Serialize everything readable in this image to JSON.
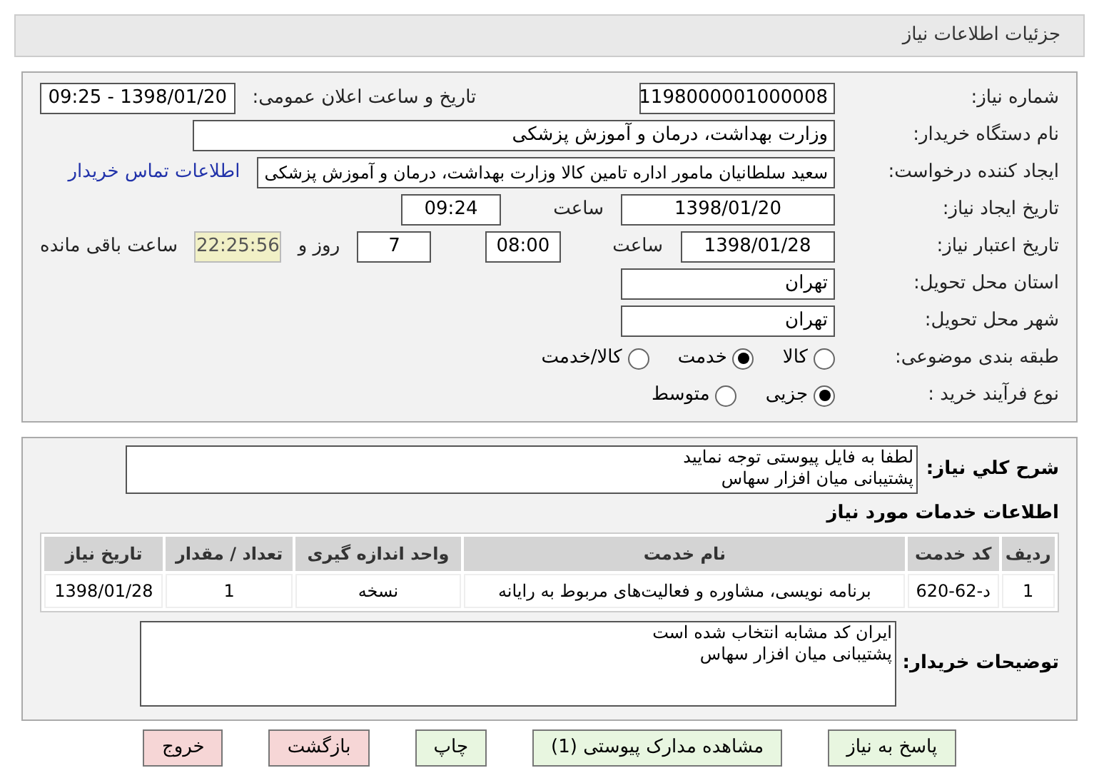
{
  "header": {
    "title": "جزئیات اطلاعات نیاز"
  },
  "details": {
    "need_number": {
      "label": "شماره نیاز:",
      "value": "1198000001000008"
    },
    "announce": {
      "label": "تاریخ و ساعت اعلان عمومی:",
      "value": "1398/01/20 - 09:25"
    },
    "buyer": {
      "label": "نام دستگاه خریدار:",
      "value": "وزارت بهداشت، درمان و آموزش پزشکی"
    },
    "creator": {
      "label": "ایجاد کننده درخواست:",
      "value": "سعید سلطانیان مامور اداره تامین کالا وزارت بهداشت، درمان و آموزش پزشکی",
      "link": "اطلاعات تماس خریدار"
    },
    "created": {
      "label": "تاریخ ایجاد نیاز:",
      "date": "1398/01/20",
      "time_label": "ساعت",
      "time": "09:24"
    },
    "validity": {
      "label": "تاریخ اعتبار نیاز:",
      "date": "1398/01/28",
      "time_label": "ساعت",
      "time": "08:00",
      "days": "7",
      "days_label": "روز و",
      "remaining": "22:25:56",
      "remaining_label": "ساعت باقی مانده"
    },
    "province": {
      "label": "استان محل تحویل:",
      "value": "تهران"
    },
    "city": {
      "label": "شهر محل تحویل:",
      "value": "تهران"
    },
    "category": {
      "label": "طبقه بندی موضوعی:",
      "options": [
        {
          "label": "کالا",
          "selected": false
        },
        {
          "label": "خدمت",
          "selected": true
        },
        {
          "label": "کالا/خدمت",
          "selected": false
        }
      ]
    },
    "process": {
      "label": "نوع فرآیند خرید :",
      "options": [
        {
          "label": "جزیی",
          "selected": true
        },
        {
          "label": "متوسط",
          "selected": false
        }
      ]
    }
  },
  "summary": {
    "label": "شرح کلي نياز:",
    "lines": [
      "لطفا به فایل پیوستی توجه نمایید",
      "پشتیبانی میان افزار سهاس"
    ]
  },
  "services": {
    "title": "اطلاعات خدمات مورد نیاز",
    "columns": [
      "ردیف",
      "کد خدمت",
      "نام خدمت",
      "واحد اندازه گیری",
      "تعداد / مقدار",
      "تاریخ نیاز"
    ],
    "rows": [
      [
        "1",
        "د-62-620",
        "برنامه نویسی، مشاوره و فعالیت‌های مربوط به رایانه",
        "نسخه",
        "1",
        "1398/01/28"
      ]
    ]
  },
  "notes": {
    "label": "توضیحات خریدار:",
    "lines": [
      "ایران کد مشابه انتخاب شده است",
      "پشتیبانی میان افزار سهاس"
    ]
  },
  "buttons": [
    {
      "label": "پاسخ به نیاز",
      "kind": "action"
    },
    {
      "label": "مشاهده مدارک پیوستی (1)",
      "kind": "action"
    },
    {
      "label": "چاپ",
      "kind": "action"
    },
    {
      "label": "بازگشت",
      "kind": "danger"
    },
    {
      "label": "خروج",
      "kind": "danger"
    }
  ]
}
